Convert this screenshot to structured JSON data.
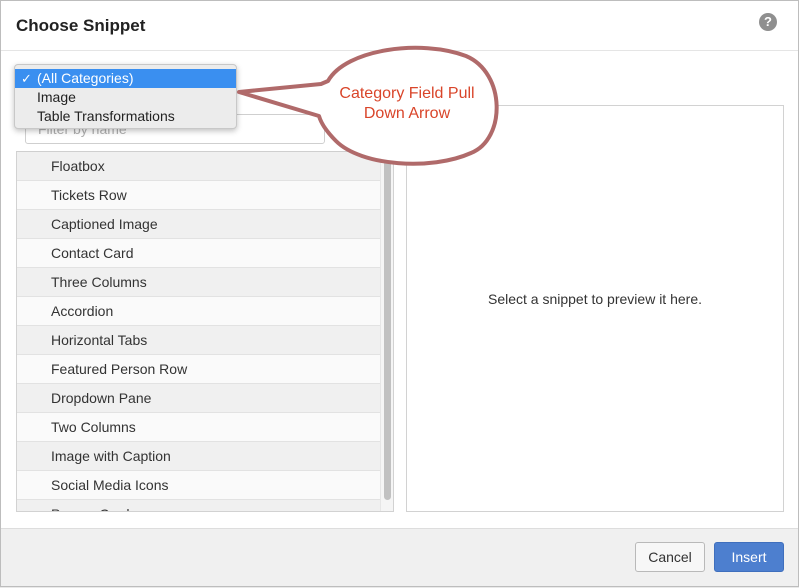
{
  "dialog": {
    "title": "Choose Snippet",
    "help_icon": "?"
  },
  "category_dropdown": {
    "options": [
      {
        "label": "(All Categories)",
        "selected": true,
        "check": "✓"
      },
      {
        "label": "Image",
        "selected": false
      },
      {
        "label": "Table Transformations",
        "selected": false
      }
    ]
  },
  "filter": {
    "placeholder": "Filter by name",
    "value": ""
  },
  "snippets": [
    "Floatbox",
    "Tickets Row",
    "Captioned Image",
    "Contact Card",
    "Three Columns",
    "Accordion",
    "Horizontal Tabs",
    "Featured Person Row",
    "Dropdown Pane",
    "Two Columns",
    "Image with Caption",
    "Social Media Icons",
    "Person Card"
  ],
  "preview": {
    "empty_text": "Select a snippet to preview it here."
  },
  "footer": {
    "cancel_label": "Cancel",
    "insert_label": "Insert"
  },
  "annotation": {
    "text_line1": "Category Field Pull",
    "text_line2": "Down Arrow"
  },
  "colors": {
    "accent": "#4d7fcf",
    "selection": "#3a8ff0",
    "annotation_text": "#d9452a",
    "annotation_stroke": "#b06a6a"
  }
}
